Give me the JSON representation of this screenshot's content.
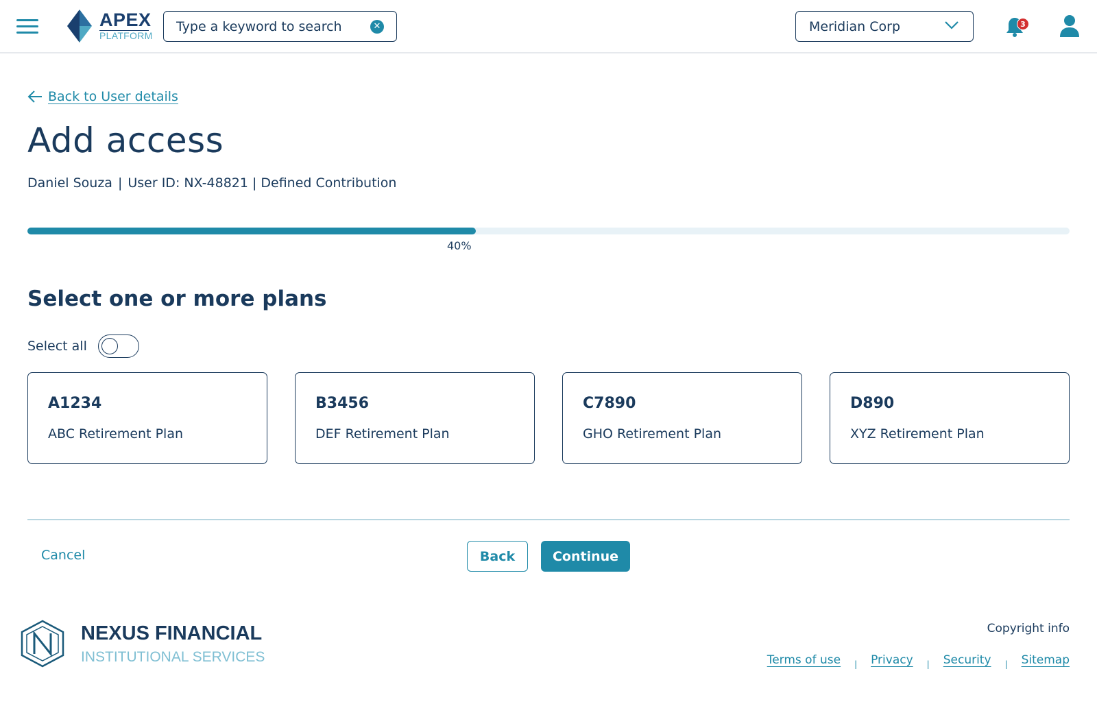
{
  "header": {
    "menu_icon": "hamburger-menu-icon",
    "brand": {
      "name": "APEX",
      "sub": "PLATFORM",
      "colors": {
        "dark": "#1a3f6e",
        "light": "#4fa9c4"
      }
    },
    "search": {
      "placeholder": "Type a keyword to search",
      "value": "",
      "clear_icon": "clear-circle-icon"
    },
    "org_select": {
      "value": "Meridian Corp",
      "icon": "chevron-down-icon"
    },
    "notifications": {
      "icon": "bell-icon",
      "count": "3"
    },
    "user_icon": "user-profile-icon"
  },
  "main": {
    "back_link": {
      "icon": "arrow-left-icon",
      "label": "Back to User details"
    },
    "title": "Add access",
    "user_meta": {
      "name": "Daniel Souza",
      "user_id": "User ID: NX-48821",
      "plan_type": "Defined Contribution"
    },
    "progress": {
      "value": 0.43,
      "label": "40%"
    },
    "section_title": "Select one or more plans",
    "select_all": {
      "label": "Select all",
      "checked": false
    },
    "plans": [
      {
        "code": "A1234",
        "name": "ABC Retirement Plan"
      },
      {
        "code": "B3456",
        "name": "DEF Retirement Plan"
      },
      {
        "code": "C7890",
        "name": "GHO Retirement Plan"
      },
      {
        "code": "D890",
        "name": "XYZ Retirement Plan"
      }
    ],
    "actions": {
      "cancel": "Cancel",
      "back": "Back",
      "continue": "Continue"
    }
  },
  "footer": {
    "brand": {
      "name": "NEXUS FINANCIAL",
      "sub": "INSTITUTIONAL SERVICES"
    },
    "copyright": "Copyright info",
    "links": [
      "Terms of use",
      "Privacy",
      "Security",
      "Sitemap"
    ]
  },
  "colors": {
    "accent": "#1f8aa8",
    "text": "#1a3a5c",
    "badge": "#d32f2f",
    "track": "#e8f2f7"
  }
}
